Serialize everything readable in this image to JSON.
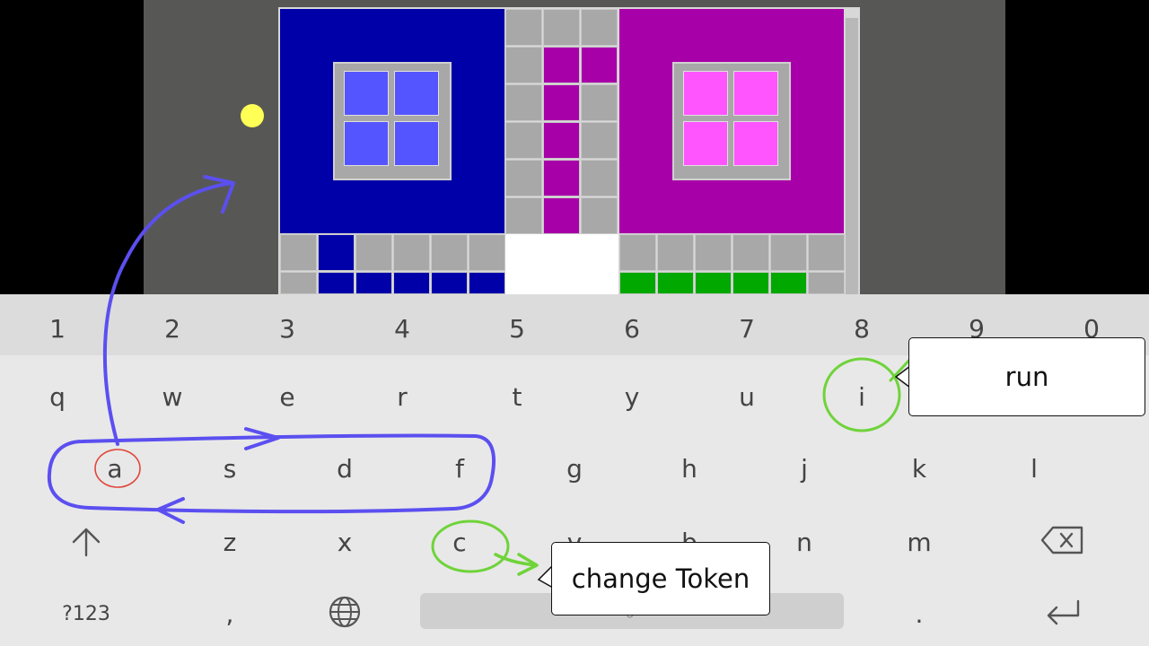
{
  "keyboard": {
    "number_row": [
      "1",
      "2",
      "3",
      "4",
      "5",
      "6",
      "7",
      "8",
      "9",
      "0"
    ],
    "row1": [
      "q",
      "w",
      "e",
      "r",
      "t",
      "y",
      "u",
      "i"
    ],
    "row2": [
      "a",
      "s",
      "d",
      "f",
      "g",
      "h",
      "j",
      "k",
      "l"
    ],
    "row3": [
      "z",
      "x",
      "c",
      "v",
      "b",
      "n",
      "m"
    ],
    "symbols_label": "?123",
    "comma_label": ",",
    "period_label": ".",
    "space_label": "English",
    "shift_icon": "shift-arrow-icon",
    "backspace_icon": "backspace-icon",
    "globe_icon": "globe-icon",
    "enter_icon": "enter-arrow-icon"
  },
  "annotations": {
    "run_label": "run",
    "change_token_label": "change Token"
  },
  "colors": {
    "board_bg": "#575856",
    "blue_block": "#0000a8",
    "blue_window": "#5555ff",
    "magenta_block": "#a800a8",
    "pink_window": "#ff55ff",
    "gray_tile": "#a8a8a8",
    "green_tile": "#00a800",
    "white_gap": "#ffffff",
    "ball": "#ffff55",
    "drawn_path": "#5b4ff0",
    "highlight_green": "#6fd33a",
    "highlight_red": "#e0463a"
  }
}
